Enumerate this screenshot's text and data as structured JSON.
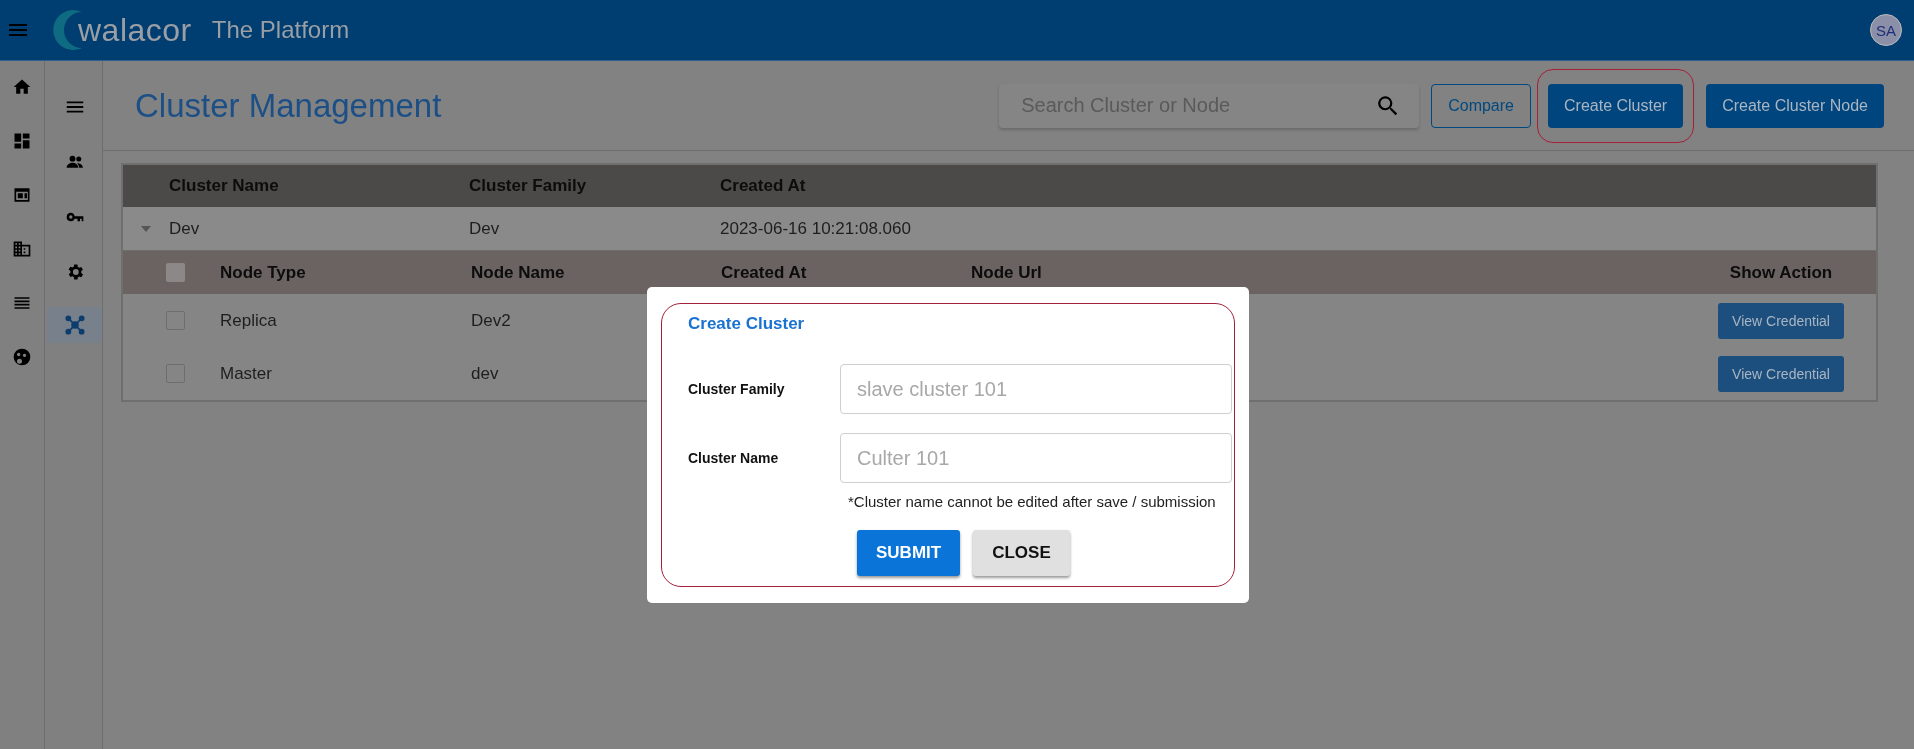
{
  "app_bar": {
    "logo": "walacor",
    "title": "The Platform",
    "avatar": "SA"
  },
  "nav": [
    {
      "kind": "menu",
      "selected": false
    },
    {
      "kind": "people",
      "selected": false
    },
    {
      "kind": "key",
      "selected": false
    },
    {
      "kind": "gear",
      "selected": false
    },
    {
      "kind": "network",
      "selected": true
    }
  ],
  "page_title": "Cluster Management",
  "search": {
    "placeholder": "Search Cluster or Node"
  },
  "toolbar_buttons": [
    {
      "label": "Compare",
      "kind": "outlined",
      "highlighted": false
    },
    {
      "label": "Create Cluster",
      "kind": "filled",
      "highlighted": true
    },
    {
      "label": "Create Cluster Node",
      "kind": "filled",
      "highlighted": false
    }
  ],
  "table": {
    "columns": [
      "Cluster Name",
      "Cluster Family",
      "Created At"
    ],
    "rows": [
      {
        "name": "Dev",
        "family": "Dev",
        "created_at": "2023-06-16 10:21:08.060",
        "expanded": true,
        "nodes": {
          "all_checked": false,
          "columns": [
            "Node Type",
            "Node Name",
            "Created At",
            "Node Url",
            "Show Action"
          ],
          "rows": [
            {
              "type": "Replica",
              "name": "Dev2",
              "action": "View Credential",
              "checked": false
            },
            {
              "type": "Master",
              "name": "dev",
              "action": "View Credential",
              "checked": false
            }
          ]
        }
      }
    ]
  },
  "dialog": {
    "title": "Create Cluster",
    "highlighted": true,
    "fields": [
      {
        "label": "Cluster Family",
        "placeholder": "slave cluster 101"
      },
      {
        "label": "Cluster Name",
        "placeholder": "Culter 101"
      }
    ],
    "note": "*Cluster name cannot be edited after save / submission",
    "buttons": [
      {
        "label": "SUBMIT",
        "kind": "primary"
      },
      {
        "label": "CLOSE",
        "kind": "secondary"
      }
    ]
  }
}
